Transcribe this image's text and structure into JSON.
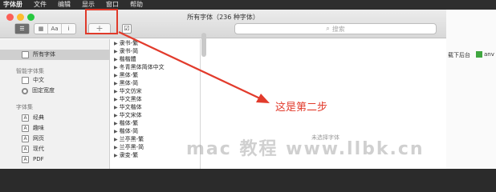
{
  "menubar": {
    "app": "字体册",
    "items": [
      "文件",
      "编辑",
      "显示",
      "窗口",
      "帮助"
    ]
  },
  "window": {
    "title": "所有字体（236 种字体）"
  },
  "toolbar": {
    "add_label": "+",
    "check_label": "☑",
    "view_buttons": [
      "☰",
      "▦",
      "Aa",
      "i"
    ],
    "search_placeholder": "搜索"
  },
  "sidebar": {
    "all_fonts": "所有字体",
    "smart_heading": "智能字体集",
    "smart_items": [
      "中文",
      "固定宽度"
    ],
    "collections_heading": "字体集",
    "collections": [
      "经典",
      "趣味",
      "网页",
      "现代",
      "PDF"
    ]
  },
  "font_list": [
    "隶书-繁",
    "隶书-简",
    "楷楷體",
    "冬青黑体简体中文",
    "黑体-繁",
    "黑体-简",
    "华文仿宋",
    "华文黑体",
    "华文楷体",
    "华文宋体",
    "楷体-繁",
    "楷体-简",
    "兰亭黑-繁",
    "兰亭黑-简",
    "隶变-繁"
  ],
  "preview": {
    "no_selection": "未选择字体"
  },
  "annotation": {
    "text": "这是第二步",
    "color": "#e23b2c"
  },
  "watermark": "mac 教程 www.llbk.cn",
  "background_app": {
    "text1": "载下后台",
    "text2": "anv"
  }
}
